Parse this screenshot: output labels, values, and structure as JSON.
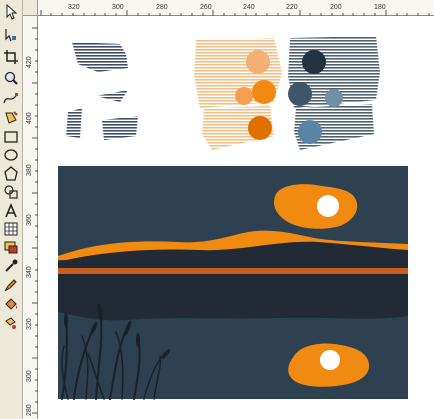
{
  "window": {
    "title": ""
  },
  "toolbox": {
    "tools": [
      {
        "name": "pick-tool",
        "icon": "arrow-pointer-icon"
      },
      {
        "name": "shape-tool",
        "icon": "node-edit-icon"
      },
      {
        "name": "crop-tool",
        "icon": "crop-icon"
      },
      {
        "name": "zoom-tool",
        "icon": "magnifier-icon"
      },
      {
        "name": "freehand-tool",
        "icon": "freehand-curve-icon"
      },
      {
        "name": "smart-fill-tool",
        "icon": "smart-fill-icon"
      },
      {
        "name": "rectangle-tool",
        "icon": "rectangle-icon"
      },
      {
        "name": "ellipse-tool",
        "icon": "ellipse-icon"
      },
      {
        "name": "polygon-tool",
        "icon": "polygon-icon"
      },
      {
        "name": "basic-shapes-tool",
        "icon": "basic-shapes-icon"
      },
      {
        "name": "text-tool",
        "icon": "text-a-icon"
      },
      {
        "name": "table-tool",
        "icon": "table-icon"
      },
      {
        "name": "dimension-tool",
        "icon": "dimension-icon"
      },
      {
        "name": "connector-tool",
        "icon": "connector-icon"
      },
      {
        "name": "blend-tool",
        "icon": "interactive-blend-icon"
      },
      {
        "name": "eyedropper-tool",
        "icon": "eyedropper-icon"
      },
      {
        "name": "outline-tool",
        "icon": "outline-pen-icon"
      },
      {
        "name": "fill-tool",
        "icon": "paint-bucket-icon"
      },
      {
        "name": "interactive-fill-tool",
        "icon": "interactive-fill-icon"
      }
    ]
  },
  "horizontal_ruler": {
    "labels": [
      "320",
      "300",
      "280",
      "260",
      "240",
      "220",
      "200",
      "180"
    ]
  },
  "vertical_ruler": {
    "labels": [
      "420",
      "400",
      "380",
      "360",
      "340",
      "320",
      "300",
      "280"
    ]
  },
  "artwork": {
    "colors": {
      "night_sky": "#2e4150",
      "hill_dark": "#222b35",
      "orange": "#f08a10",
      "rust_stripe": "#c95f1e",
      "white_moon": "#ffffff",
      "reed_silhouette": "#1b2128",
      "pale_orange": "#f3bf86",
      "steel_blue": "#5a84a6",
      "slate": "#3d5669",
      "navy_lines": "#3e4d6b"
    }
  }
}
